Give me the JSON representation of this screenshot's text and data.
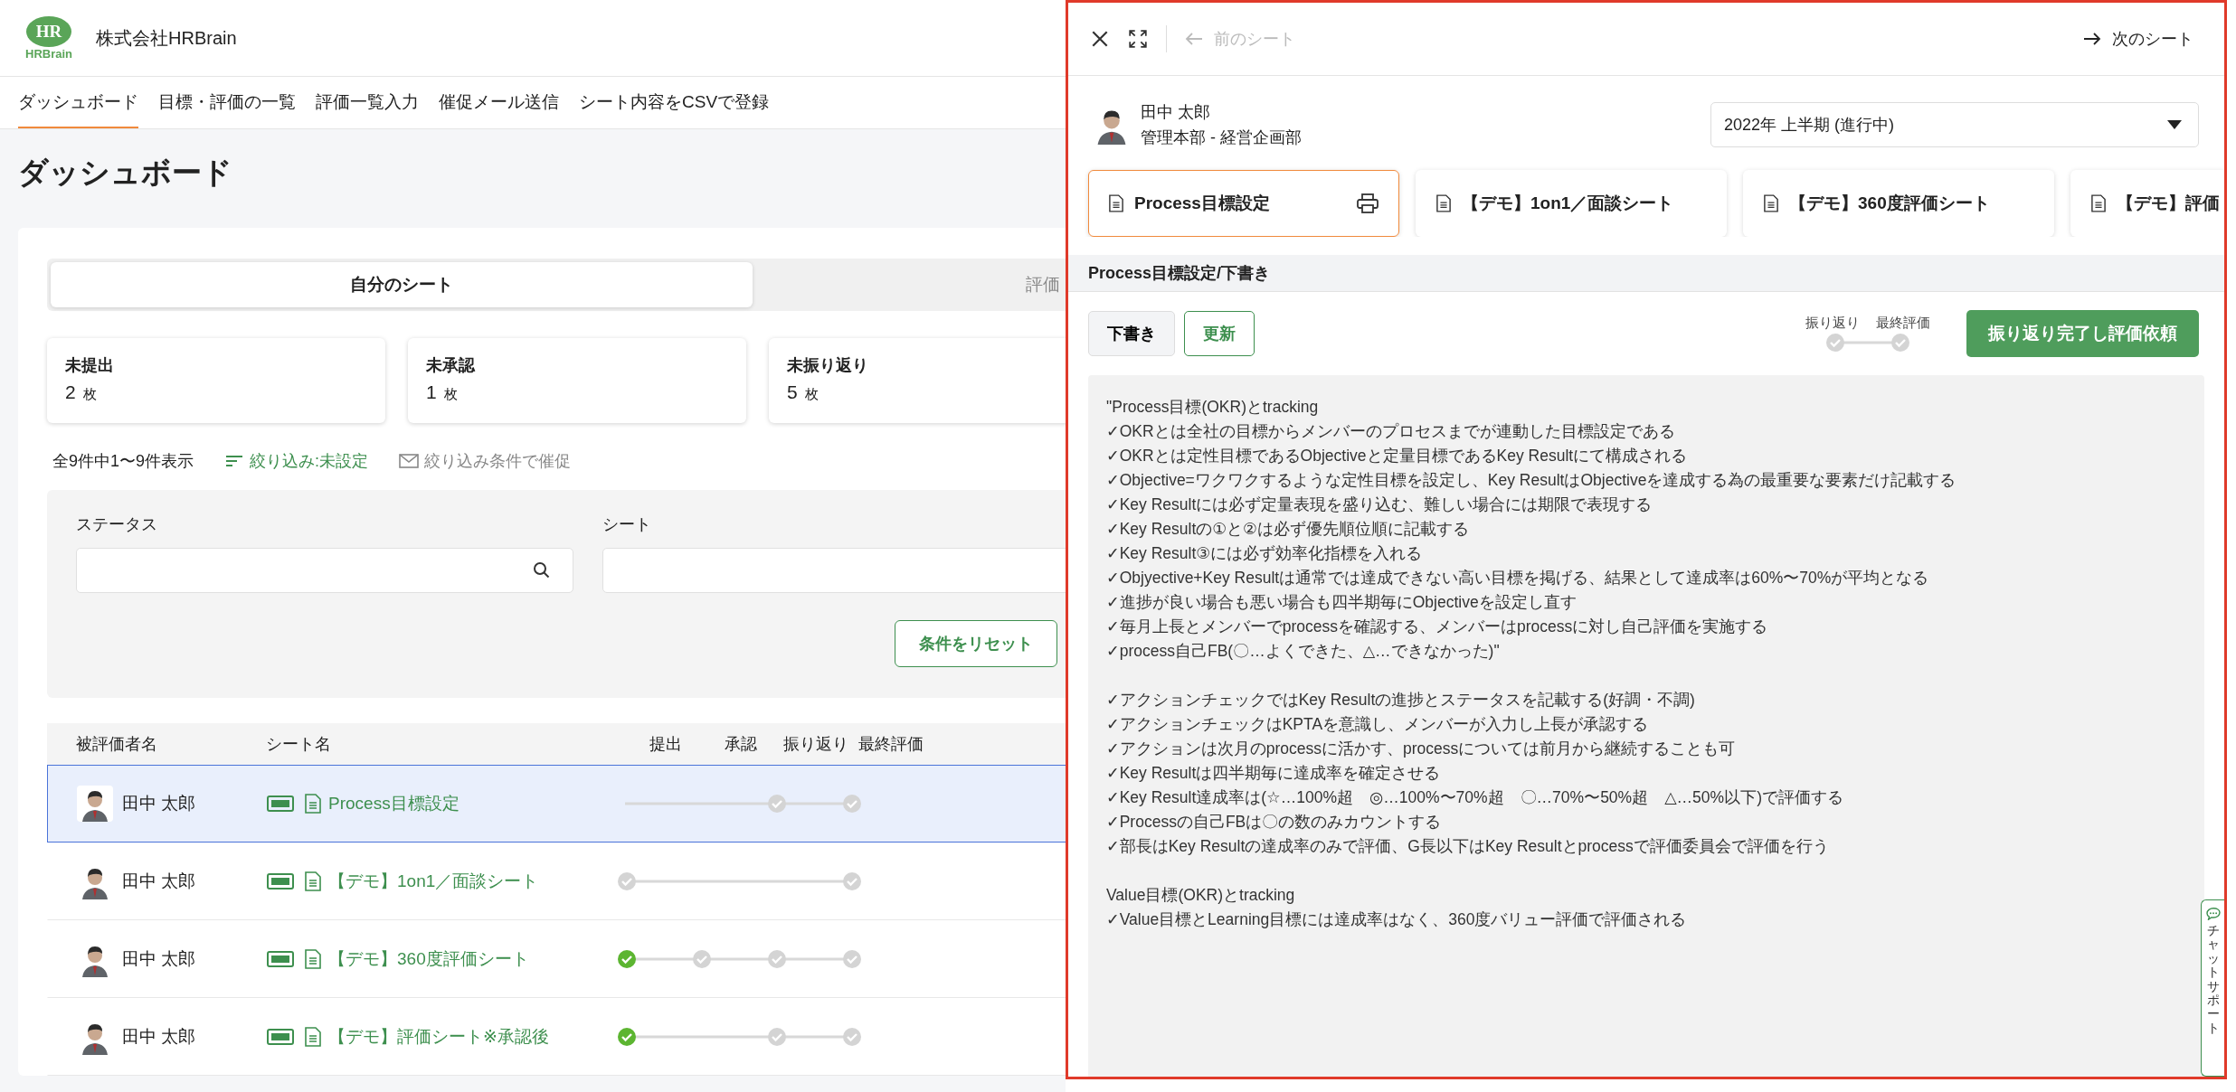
{
  "header": {
    "logo_mark": "HR",
    "logo_text": "HRBrain",
    "company": "株式会社HRBrain"
  },
  "nav": [
    {
      "label": "ダッシュボード",
      "selected": true
    },
    {
      "label": "目標・評価の一覧",
      "selected": false
    },
    {
      "label": "評価一覧入力",
      "selected": false
    },
    {
      "label": "催促メール送信",
      "selected": false
    },
    {
      "label": "シート内容をCSVで登録",
      "selected": false
    }
  ],
  "page_title": "ダッシュボード",
  "tabs": [
    {
      "label": "自分のシート",
      "selected": true
    },
    {
      "label": "評価",
      "selected": false
    }
  ],
  "stats": [
    {
      "label": "未提出",
      "count": "2",
      "unit": "枚"
    },
    {
      "label": "未承認",
      "count": "1",
      "unit": "枚"
    },
    {
      "label": "未振り返り",
      "count": "5",
      "unit": "枚"
    }
  ],
  "summary": {
    "count_text": "全9件中1〜9件表示",
    "filter_link": "絞り込み:未設定",
    "remind_link": "絞り込み条件で催促"
  },
  "filters": {
    "fields": [
      {
        "label": "ステータス"
      },
      {
        "label": "シート"
      }
    ],
    "reset_button": "条件をリセット"
  },
  "table": {
    "columns": [
      "被評価者名",
      "シート名",
      "提出",
      "承認",
      "振り返り",
      "最終評価"
    ],
    "rows": [
      {
        "name": "田中 太郎",
        "sheet": "Process目標設定",
        "selected": true,
        "steps": [
          {
            "kind": "blank"
          },
          {
            "kind": "blank"
          },
          {
            "kind": "pending"
          },
          {
            "kind": "pending"
          }
        ]
      },
      {
        "name": "田中 太郎",
        "sheet": "【デモ】1on1／面談シート",
        "selected": false,
        "steps": [
          {
            "kind": "pending"
          },
          {
            "kind": "blank"
          },
          {
            "kind": "blank"
          },
          {
            "kind": "pending"
          }
        ]
      },
      {
        "name": "田中 太郎",
        "sheet": "【デモ】360度評価シート",
        "selected": false,
        "steps": [
          {
            "kind": "done"
          },
          {
            "kind": "pending"
          },
          {
            "kind": "pending"
          },
          {
            "kind": "pending"
          }
        ]
      },
      {
        "name": "田中 太郎",
        "sheet": "【デモ】評価シート※承認後",
        "selected": false,
        "steps": [
          {
            "kind": "done"
          },
          {
            "kind": "blank"
          },
          {
            "kind": "pending"
          },
          {
            "kind": "pending"
          }
        ]
      }
    ]
  },
  "panel": {
    "prev": {
      "label": "前のシート",
      "disabled": true
    },
    "next": {
      "label": "次のシート",
      "disabled": false
    },
    "user": {
      "name": "田中 太郎",
      "department": "管理本部 - 経営企画部"
    },
    "period": "2022年 上半期 (進行中)",
    "sheet_tabs": [
      {
        "label": "Process目標設定",
        "selected": true
      },
      {
        "label": "【デモ】1on1／面談シート",
        "selected": false
      },
      {
        "label": "【デモ】360度評価シート",
        "selected": false
      },
      {
        "label": "【デモ】評価",
        "selected": false
      }
    ],
    "section_title": "Process目標設定/下書き",
    "status_button": "下書き",
    "update_button": "更新",
    "progress": [
      {
        "label": "振り返り",
        "kind": "pending"
      },
      {
        "label": "最終評価",
        "kind": "pending"
      }
    ],
    "submit_button": "振り返り完了し評価依頼",
    "content": [
      [
        "\"Process目標(OKR)とtracking",
        "✓OKRとは全社の目標からメンバーのプロセスまでが連動した目標設定である",
        "✓OKRとは定性目標であるObjectiveと定量目標であるKey Resultにて構成される",
        "✓Objective=ワクワクするような定性目標を設定し、Key ResultはObjectiveを達成する為の最重要な要素だけ記載する",
        "✓Key Resultには必ず定量表現を盛り込む、難しい場合には期限で表現する",
        "✓Key Resultの①と②は必ず優先順位順に記載する",
        "✓Key Result③には必ず効率化指標を入れる",
        "✓Objyective+Key Resultは通常では達成できない高い目標を掲げる、結果として達成率は60%〜70%が平均となる",
        "✓進捗が良い場合も悪い場合も四半期毎にObjectiveを設定し直す",
        "✓毎月上長とメンバーでprocessを確認する、メンバーはprocessに対し自己評価を実施する",
        "✓process自己FB(〇…よくできた、△…できなかった)\""
      ],
      [
        "✓アクションチェックではKey Resultの進捗とステータスを記載する(好調・不調)",
        "✓アクションチェックはKPTAを意識し、メンバーが入力し上長が承認する",
        "✓アクションは次月のprocessに活かす、processについては前月から継続することも可",
        "✓Key Resultは四半期毎に達成率を確定させる",
        "✓Key Result達成率は(☆…100%超　◎…100%〜70%超　〇…70%〜50%超　△…50%以下)で評価する",
        "✓Processの自己FBは〇の数のみカウントする",
        "✓部長はKey Resultの達成率のみで評価、G長以下はKey Resultとprocessで評価委員会で評価を行う"
      ],
      [
        "Value目標(OKR)とtracking",
        "✓Value目標とLearning目標には達成率はなく、360度バリュー評価で評価される"
      ]
    ]
  },
  "chat_support": "チャットサポート"
}
